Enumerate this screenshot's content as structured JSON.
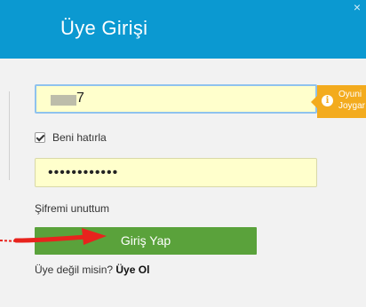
{
  "header": {
    "title": "Üye Girişi",
    "close_label": "×"
  },
  "form": {
    "username_value": "7",
    "password_mask": "••••••••••••",
    "remember_label": "Beni hatırla",
    "remember_checked": true,
    "forgot_label": "Şifremi unuttum",
    "login_label": "Giriş Yap",
    "signup_prompt": "Üye değil misin?",
    "signup_link": "Üye Ol"
  },
  "tooltip": {
    "icon": "info-icon",
    "line1": "Oyuni",
    "line2": "Joygar"
  },
  "colors": {
    "header_bg": "#0b99d1",
    "panel_bg": "#f2f2f2",
    "field_bg": "#ffffcc",
    "login_button": "#5aa23b",
    "tooltip_bg": "#f3ab1e",
    "arrow": "#e8231d"
  }
}
